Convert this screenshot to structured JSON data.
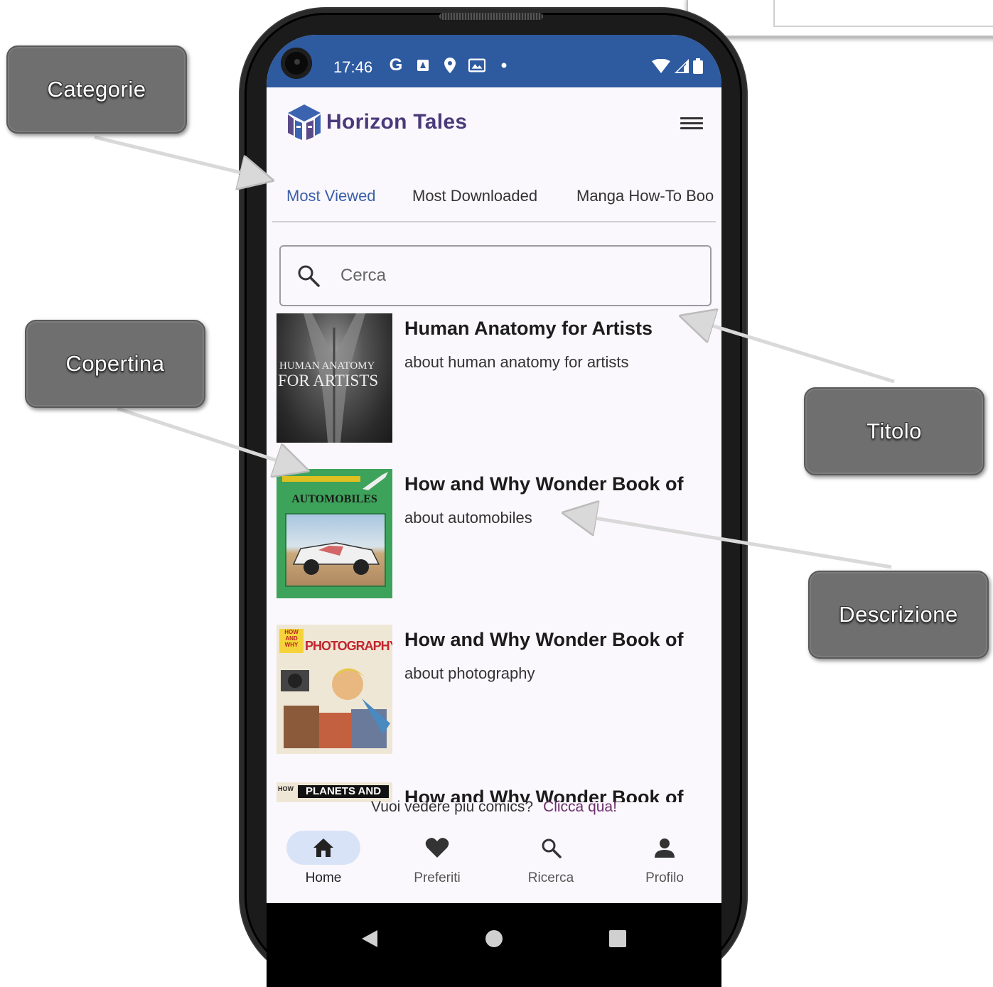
{
  "annotations": {
    "categorie": "Categorie",
    "copertina": "Copertina",
    "titolo": "Titolo",
    "descrizione": "Descrizione"
  },
  "status_bar": {
    "time": "17:46"
  },
  "app": {
    "title": "Horizon Tales",
    "brand_color": "#4a3a7a",
    "status_bar_color": "#2e5aa0"
  },
  "tabs": [
    {
      "label": "Most Viewed",
      "active": true
    },
    {
      "label": "Most Downloaded",
      "active": false
    },
    {
      "label": "Manga How-To Boo",
      "active": false
    }
  ],
  "search": {
    "placeholder": "Cerca",
    "icon": "search-icon"
  },
  "books": [
    {
      "title": "Human Anatomy for Artists",
      "description": "about human anatomy for artists",
      "cover_text_line1": "HUMAN ANATOMY",
      "cover_text_line2": "FOR ARTISTS"
    },
    {
      "title": "How and Why Wonder Book of",
      "description": "about automobiles",
      "cover_text": "AUTOMOBILES"
    },
    {
      "title": "How and Why Wonder Book of",
      "description": "about photography",
      "cover_text": "PHOTOGRAPHY",
      "cover_badge": "HOW AND WHY"
    },
    {
      "title": "How and Why Wonder Book of",
      "description": "",
      "cover_text": "PLANETS AND",
      "cover_badge": "HOW"
    }
  ],
  "footer": {
    "prompt": "Vuoi vedere più comics?",
    "link": "Clicca qua!"
  },
  "bottom_nav": [
    {
      "label": "Home",
      "icon": "home-icon",
      "active": true
    },
    {
      "label": "Preferiti",
      "icon": "heart-icon",
      "active": false
    },
    {
      "label": "Ricerca",
      "icon": "search-icon",
      "active": false
    },
    {
      "label": "Profilo",
      "icon": "person-icon",
      "active": false
    }
  ]
}
